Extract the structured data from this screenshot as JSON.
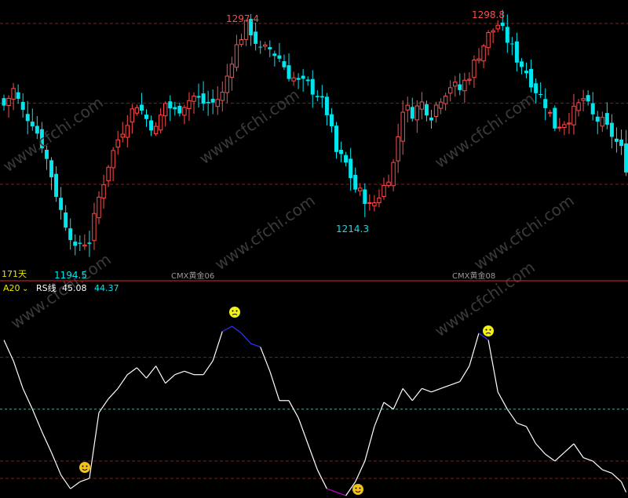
{
  "colors": {
    "background": "#000000",
    "up": "#ff4b4b",
    "down": "#00e5ee",
    "grid": "#8b1a1a",
    "separator": "#b02020",
    "rs_line": "#ffffff",
    "rs_high": "#3333ff",
    "rs_low": "#cc00cc",
    "midline": "#00c8c8",
    "label_yellow": "#e6e600",
    "watermark": "#3a3a3a"
  },
  "panel_top": {
    "period_label": "171天",
    "contract_labels": [
      "CMX黄金06",
      "CMX黄金08"
    ],
    "high_labels": [
      "1297.4",
      "1298.8"
    ],
    "low_labels": [
      "1194.5",
      "1214.3"
    ]
  },
  "panel_bottom": {
    "indicator_name": "A20",
    "series_label": "RS线",
    "value1": "45.08",
    "value2": "44.37",
    "marker_icons": [
      "frown-face-icon",
      "frown-face-icon",
      "smile-face-icon",
      "smile-face-icon"
    ]
  },
  "watermark_text": "www.cfchi.com",
  "chart_data": [
    {
      "type": "candlestick",
      "title": "",
      "ylim": [
        1186,
        1305
      ],
      "price_gridlines": [
        1297.4,
        1262,
        1226
      ],
      "high": 1298.8,
      "low": 1194.5,
      "annotations": [
        {
          "text": "1297.4",
          "value": 1297.4,
          "kind": "high",
          "bar": 51
        },
        {
          "text": "1194.5",
          "value": 1194.5,
          "kind": "low",
          "bar": 15
        },
        {
          "text": "1214.3",
          "value": 1214.3,
          "kind": "low",
          "bar": 77
        },
        {
          "text": "1298.8",
          "value": 1298.8,
          "kind": "high",
          "bar": 104
        }
      ],
      "close_path": [
        [
          0,
          1261
        ],
        [
          2,
          1268
        ],
        [
          4,
          1258
        ],
        [
          6,
          1254
        ],
        [
          8,
          1244
        ],
        [
          10,
          1230
        ],
        [
          12,
          1214
        ],
        [
          14,
          1204
        ],
        [
          15,
          1196
        ],
        [
          16,
          1200
        ],
        [
          18,
          1201
        ],
        [
          20,
          1220
        ],
        [
          22,
          1235
        ],
        [
          24,
          1246
        ],
        [
          26,
          1255
        ],
        [
          28,
          1262
        ],
        [
          30,
          1255
        ],
        [
          32,
          1250
        ],
        [
          34,
          1262
        ],
        [
          36,
          1258
        ],
        [
          38,
          1262
        ],
        [
          40,
          1265
        ],
        [
          42,
          1262
        ],
        [
          44,
          1262
        ],
        [
          46,
          1266
        ],
        [
          48,
          1282
        ],
        [
          50,
          1292
        ],
        [
          51,
          1296
        ],
        [
          52,
          1294
        ],
        [
          54,
          1285
        ],
        [
          56,
          1286
        ],
        [
          58,
          1282
        ],
        [
          60,
          1275
        ],
        [
          62,
          1271
        ],
        [
          64,
          1270
        ],
        [
          66,
          1266
        ],
        [
          68,
          1258
        ],
        [
          70,
          1240
        ],
        [
          72,
          1235
        ],
        [
          74,
          1224
        ],
        [
          76,
          1220
        ],
        [
          77,
          1216
        ],
        [
          78,
          1218
        ],
        [
          80,
          1225
        ],
        [
          82,
          1235
        ],
        [
          84,
          1260
        ],
        [
          86,
          1258
        ],
        [
          88,
          1262
        ],
        [
          90,
          1257
        ],
        [
          92,
          1265
        ],
        [
          94,
          1270
        ],
        [
          96,
          1268
        ],
        [
          98,
          1275
        ],
        [
          100,
          1284
        ],
        [
          102,
          1292
        ],
        [
          104,
          1297
        ],
        [
          106,
          1290
        ],
        [
          108,
          1282
        ],
        [
          110,
          1276
        ],
        [
          112,
          1268
        ],
        [
          114,
          1262
        ],
        [
          116,
          1252
        ],
        [
          118,
          1254
        ],
        [
          120,
          1258
        ],
        [
          122,
          1264
        ],
        [
          124,
          1256
        ],
        [
          126,
          1253
        ],
        [
          128,
          1248
        ],
        [
          130,
          1241
        ],
        [
          131,
          1234
        ]
      ]
    },
    {
      "type": "line",
      "title": "",
      "series": [
        {
          "name": "RS线",
          "last": 45.08
        }
      ],
      "ylim": [
        0,
        100
      ],
      "reference_levels": [
        80,
        50,
        20,
        10
      ],
      "x": [
        0,
        2,
        4,
        6,
        8,
        10,
        12,
        14,
        16,
        18,
        20,
        22,
        24,
        26,
        28,
        30,
        32,
        34,
        36,
        38,
        40,
        42,
        44,
        46,
        48,
        50,
        52,
        54,
        56,
        58,
        60,
        62,
        64,
        66,
        68,
        70,
        72,
        74,
        76,
        78,
        80,
        82,
        84,
        86,
        88,
        90,
        92,
        94,
        96,
        98,
        100,
        102,
        104,
        106,
        108,
        110,
        112,
        114,
        116,
        118,
        120,
        122,
        124,
        126,
        128,
        130,
        131
      ],
      "values": [
        90,
        78,
        62,
        50,
        37,
        25,
        12,
        4,
        8,
        10,
        48,
        56,
        62,
        70,
        74,
        68,
        75,
        65,
        70,
        72,
        70,
        70,
        78,
        95,
        98,
        94,
        88,
        86,
        72,
        55,
        55,
        45,
        30,
        15,
        4,
        2,
        0,
        8,
        20,
        40,
        54,
        50,
        62,
        55,
        62,
        60,
        62,
        64,
        66,
        75,
        94,
        90,
        60,
        50,
        42,
        40,
        30,
        24,
        20,
        25,
        30,
        22,
        20,
        15,
        13,
        8,
        2
      ]
    }
  ]
}
